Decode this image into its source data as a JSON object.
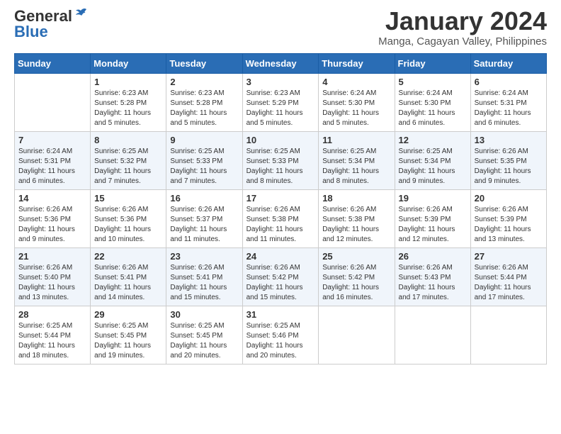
{
  "header": {
    "logo_general": "General",
    "logo_blue": "Blue",
    "month_year": "January 2024",
    "location": "Manga, Cagayan Valley, Philippines"
  },
  "days_of_week": [
    "Sunday",
    "Monday",
    "Tuesday",
    "Wednesday",
    "Thursday",
    "Friday",
    "Saturday"
  ],
  "weeks": [
    [
      {
        "day": "",
        "info": ""
      },
      {
        "day": "1",
        "info": "Sunrise: 6:23 AM\nSunset: 5:28 PM\nDaylight: 11 hours\nand 5 minutes."
      },
      {
        "day": "2",
        "info": "Sunrise: 6:23 AM\nSunset: 5:28 PM\nDaylight: 11 hours\nand 5 minutes."
      },
      {
        "day": "3",
        "info": "Sunrise: 6:23 AM\nSunset: 5:29 PM\nDaylight: 11 hours\nand 5 minutes."
      },
      {
        "day": "4",
        "info": "Sunrise: 6:24 AM\nSunset: 5:30 PM\nDaylight: 11 hours\nand 5 minutes."
      },
      {
        "day": "5",
        "info": "Sunrise: 6:24 AM\nSunset: 5:30 PM\nDaylight: 11 hours\nand 6 minutes."
      },
      {
        "day": "6",
        "info": "Sunrise: 6:24 AM\nSunset: 5:31 PM\nDaylight: 11 hours\nand 6 minutes."
      }
    ],
    [
      {
        "day": "7",
        "info": "Sunrise: 6:24 AM\nSunset: 5:31 PM\nDaylight: 11 hours\nand 6 minutes."
      },
      {
        "day": "8",
        "info": "Sunrise: 6:25 AM\nSunset: 5:32 PM\nDaylight: 11 hours\nand 7 minutes."
      },
      {
        "day": "9",
        "info": "Sunrise: 6:25 AM\nSunset: 5:33 PM\nDaylight: 11 hours\nand 7 minutes."
      },
      {
        "day": "10",
        "info": "Sunrise: 6:25 AM\nSunset: 5:33 PM\nDaylight: 11 hours\nand 8 minutes."
      },
      {
        "day": "11",
        "info": "Sunrise: 6:25 AM\nSunset: 5:34 PM\nDaylight: 11 hours\nand 8 minutes."
      },
      {
        "day": "12",
        "info": "Sunrise: 6:25 AM\nSunset: 5:34 PM\nDaylight: 11 hours\nand 9 minutes."
      },
      {
        "day": "13",
        "info": "Sunrise: 6:26 AM\nSunset: 5:35 PM\nDaylight: 11 hours\nand 9 minutes."
      }
    ],
    [
      {
        "day": "14",
        "info": "Sunrise: 6:26 AM\nSunset: 5:36 PM\nDaylight: 11 hours\nand 9 minutes."
      },
      {
        "day": "15",
        "info": "Sunrise: 6:26 AM\nSunset: 5:36 PM\nDaylight: 11 hours\nand 10 minutes."
      },
      {
        "day": "16",
        "info": "Sunrise: 6:26 AM\nSunset: 5:37 PM\nDaylight: 11 hours\nand 11 minutes."
      },
      {
        "day": "17",
        "info": "Sunrise: 6:26 AM\nSunset: 5:38 PM\nDaylight: 11 hours\nand 11 minutes."
      },
      {
        "day": "18",
        "info": "Sunrise: 6:26 AM\nSunset: 5:38 PM\nDaylight: 11 hours\nand 12 minutes."
      },
      {
        "day": "19",
        "info": "Sunrise: 6:26 AM\nSunset: 5:39 PM\nDaylight: 11 hours\nand 12 minutes."
      },
      {
        "day": "20",
        "info": "Sunrise: 6:26 AM\nSunset: 5:39 PM\nDaylight: 11 hours\nand 13 minutes."
      }
    ],
    [
      {
        "day": "21",
        "info": "Sunrise: 6:26 AM\nSunset: 5:40 PM\nDaylight: 11 hours\nand 13 minutes."
      },
      {
        "day": "22",
        "info": "Sunrise: 6:26 AM\nSunset: 5:41 PM\nDaylight: 11 hours\nand 14 minutes."
      },
      {
        "day": "23",
        "info": "Sunrise: 6:26 AM\nSunset: 5:41 PM\nDaylight: 11 hours\nand 15 minutes."
      },
      {
        "day": "24",
        "info": "Sunrise: 6:26 AM\nSunset: 5:42 PM\nDaylight: 11 hours\nand 15 minutes."
      },
      {
        "day": "25",
        "info": "Sunrise: 6:26 AM\nSunset: 5:42 PM\nDaylight: 11 hours\nand 16 minutes."
      },
      {
        "day": "26",
        "info": "Sunrise: 6:26 AM\nSunset: 5:43 PM\nDaylight: 11 hours\nand 17 minutes."
      },
      {
        "day": "27",
        "info": "Sunrise: 6:26 AM\nSunset: 5:44 PM\nDaylight: 11 hours\nand 17 minutes."
      }
    ],
    [
      {
        "day": "28",
        "info": "Sunrise: 6:25 AM\nSunset: 5:44 PM\nDaylight: 11 hours\nand 18 minutes."
      },
      {
        "day": "29",
        "info": "Sunrise: 6:25 AM\nSunset: 5:45 PM\nDaylight: 11 hours\nand 19 minutes."
      },
      {
        "day": "30",
        "info": "Sunrise: 6:25 AM\nSunset: 5:45 PM\nDaylight: 11 hours\nand 20 minutes."
      },
      {
        "day": "31",
        "info": "Sunrise: 6:25 AM\nSunset: 5:46 PM\nDaylight: 11 hours\nand 20 minutes."
      },
      {
        "day": "",
        "info": ""
      },
      {
        "day": "",
        "info": ""
      },
      {
        "day": "",
        "info": ""
      }
    ]
  ]
}
